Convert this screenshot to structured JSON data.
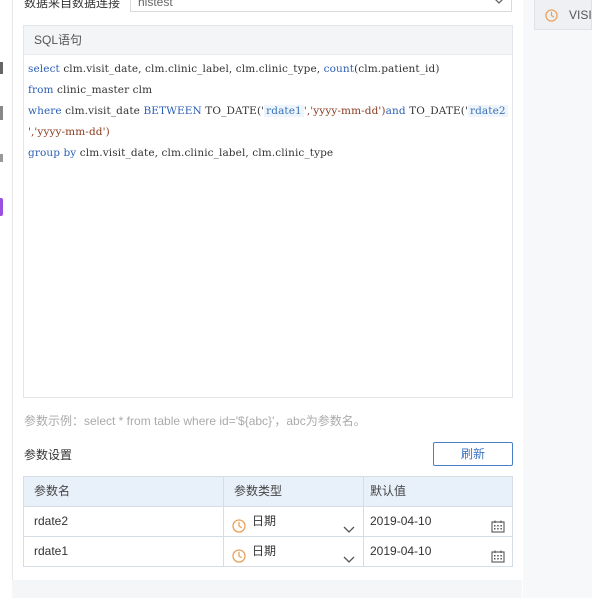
{
  "datasource": {
    "label": "数据来自数据连接",
    "value": "histest"
  },
  "right_panel": {
    "item_label": "VISI"
  },
  "sql": {
    "header": "SQL语句",
    "lines": [
      [
        {
          "t": "select",
          "c": "kw"
        },
        {
          "t": " clm.visit_date, clm.clinic_label, clm.clinic_type, ",
          "c": ""
        },
        {
          "t": "count",
          "c": "kw"
        },
        {
          "t": "(clm.patient_id)",
          "c": ""
        }
      ],
      [
        {
          "t": "from",
          "c": "kw"
        },
        {
          "t": " clinic_master clm",
          "c": ""
        }
      ],
      [
        {
          "t": "where",
          "c": "kw"
        },
        {
          "t": " clm.visit_date ",
          "c": ""
        },
        {
          "t": "BETWEEN",
          "c": "kw"
        },
        {
          "t": " TO_DATE('",
          "c": ""
        },
        {
          "t": "rdate1",
          "c": "param"
        },
        {
          "t": "','yyyy-mm-dd')",
          "c": "str"
        },
        {
          "t": "and",
          "c": "kw"
        },
        {
          "t": " TO_DATE('",
          "c": ""
        },
        {
          "t": "rdate2",
          "c": "param"
        }
      ],
      [
        {
          "t": "','yyyy-mm-dd')",
          "c": "str"
        }
      ],
      [
        {
          "t": "group by",
          "c": "kw"
        },
        {
          "t": " clm.visit_date, clm.clinic_label, clm.clinic_type",
          "c": ""
        }
      ]
    ]
  },
  "hint": "参数示例：select * from table where id='${abc}'，abc为参数名。",
  "params": {
    "title": "参数设置",
    "refresh_label": "刷新",
    "columns": [
      "参数名",
      "参数类型",
      "默认值"
    ],
    "rows": [
      {
        "name": "rdate2",
        "type": "日期",
        "default": "2019-04-10"
      },
      {
        "name": "rdate1",
        "type": "日期",
        "default": "2019-04-10"
      }
    ]
  },
  "colors": {
    "accent": "#4a7fc7",
    "keyword": "#2b5fb3",
    "clock_orange": "#e8a15a",
    "header_bg": "#e8f0fa"
  },
  "icons": {
    "type_icon": "clock-icon",
    "date_icon": "calendar-icon",
    "dropdown_icon": "chevron-down-icon"
  }
}
